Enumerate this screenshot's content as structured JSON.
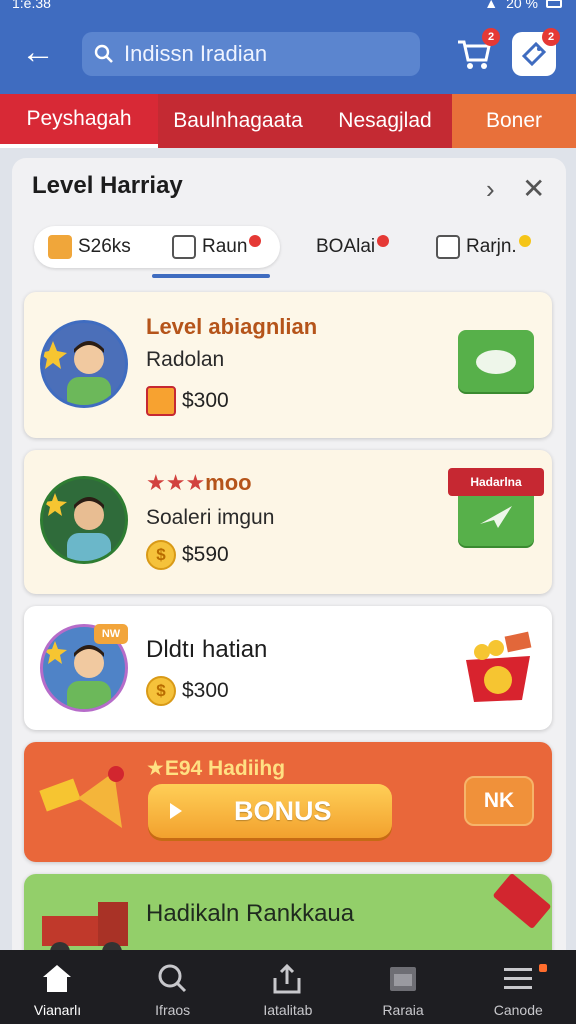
{
  "status": {
    "time": "1:e.38",
    "battery": "20 %"
  },
  "appbar": {
    "search_text": "Indissn Iradian",
    "cart_badge": "2",
    "gift_badge": "2"
  },
  "categories": [
    "Peyshagah",
    "Baulnhagaata",
    "Nesagjlad",
    "Boner"
  ],
  "sheet": {
    "title": "Level Harriay",
    "tabs": [
      "S26ks",
      "Raun",
      "BOAlai",
      "Rarjn."
    ]
  },
  "cards": [
    {
      "title": "Level abiagnlian",
      "subtitle": "Radolan",
      "price": "$300"
    },
    {
      "title": "moo",
      "subtitle": "Soaleri imgun",
      "price": "$590",
      "ribbon": "Hadarlna"
    },
    {
      "title": "Dldtı hatian",
      "price": "$300",
      "badge": "NW"
    },
    {
      "title": "E94 Hadiihg",
      "button": "BONUS",
      "side_button": "NK"
    },
    {
      "title": "Hadikaln Rankkaua"
    }
  ],
  "bottom_nav": [
    {
      "label": "Vianarlı",
      "icon": "home-icon"
    },
    {
      "label": "Ifraos",
      "icon": "search-icon"
    },
    {
      "label": "Iatalitab",
      "icon": "share-icon"
    },
    {
      "label": "Raraia",
      "icon": "calendar-icon"
    },
    {
      "label": "Canode",
      "icon": "menu-icon"
    }
  ],
  "colors": {
    "brand_blue": "#3f6cc0",
    "category_red": "#c42a33",
    "accent_orange": "#e9673a",
    "green": "#57b04a"
  }
}
